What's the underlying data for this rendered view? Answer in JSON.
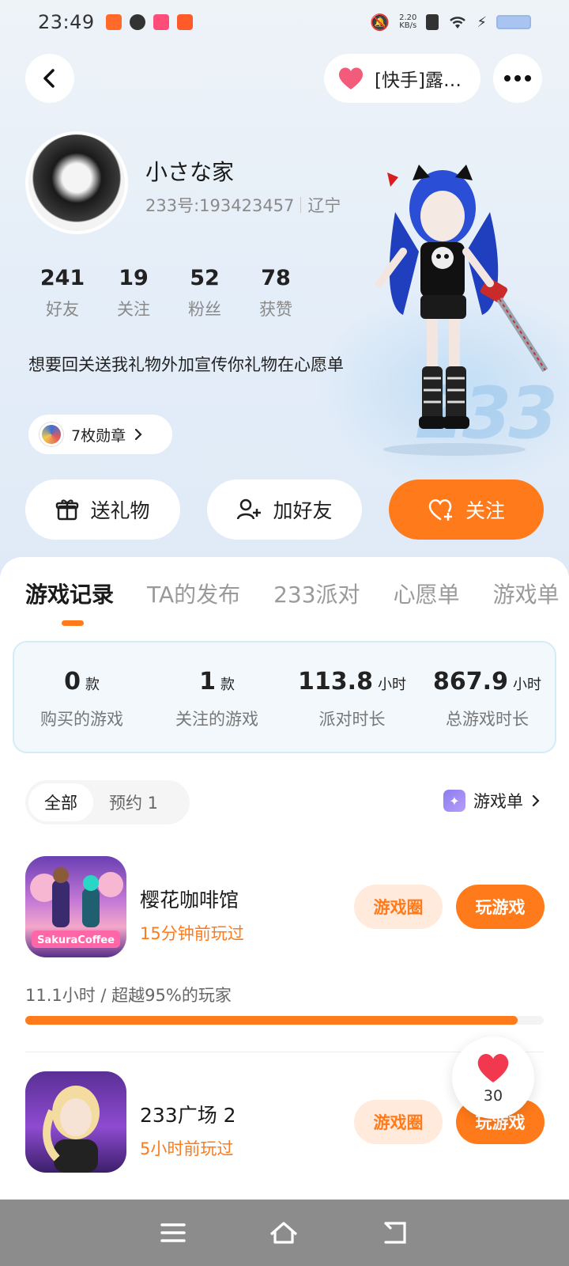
{
  "status_bar": {
    "time": "23:49",
    "net_speed_top": "2.20",
    "net_speed_bottom": "KB/s"
  },
  "header": {
    "vip_pill_text": "[快手]露…"
  },
  "profile": {
    "name": "小さな家",
    "uid": "233号:193423457",
    "region": "辽宁",
    "stats": [
      {
        "num": "241",
        "label": "好友"
      },
      {
        "num": "19",
        "label": "关注"
      },
      {
        "num": "52",
        "label": "粉丝"
      },
      {
        "num": "78",
        "label": "获赞"
      }
    ],
    "bio": "想要回关送我礼物外加宣传你礼物在心愿单",
    "medals_label": "7枚勋章"
  },
  "actions": {
    "gift": "送礼物",
    "add_friend": "加好友",
    "follow": "关注"
  },
  "tabs": [
    "游戏记录",
    "TA的发布",
    "233派对",
    "心愿单",
    "游戏单"
  ],
  "summary": [
    {
      "value": "0",
      "unit": "款",
      "label": "购买的游戏"
    },
    {
      "value": "1",
      "unit": "款",
      "label": "关注的游戏"
    },
    {
      "value": "113.8",
      "unit": "小时",
      "label": "派对时长"
    },
    {
      "value": "867.9",
      "unit": "小时",
      "label": "总游戏时长"
    }
  ],
  "filter": {
    "all": "全部",
    "reserve": "预约 1",
    "game_list": "游戏单"
  },
  "games": [
    {
      "name": "樱花咖啡馆",
      "played": "15分钟前玩过",
      "circle_btn": "游戏圈",
      "play_btn": "玩游戏",
      "icon_text": "SakuraCoffee",
      "progress_text": "11.1小时 / 超越95%的玩家",
      "progress": 0.95
    },
    {
      "name": "233广场 2",
      "played": "5小时前玩过",
      "circle_btn": "游戏圈",
      "play_btn": "玩游戏"
    }
  ],
  "float_like": {
    "count": "30"
  },
  "colors": {
    "accent": "#ff7a1a",
    "accent_light": "#ffeadc",
    "summary_bg": "#f2f8fc"
  }
}
